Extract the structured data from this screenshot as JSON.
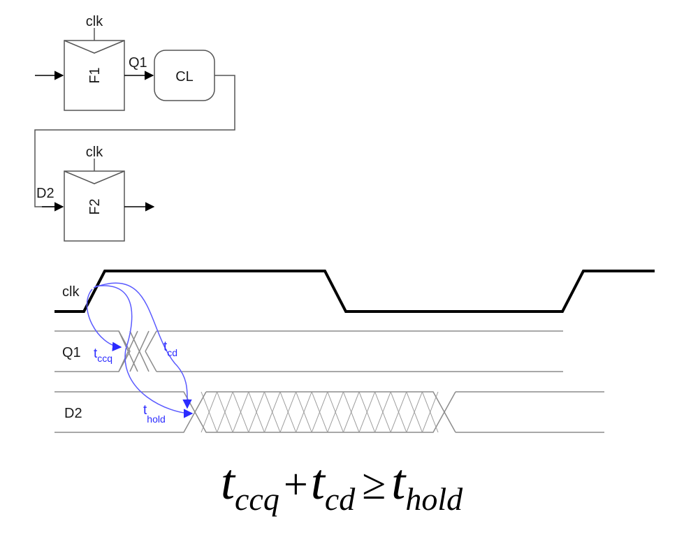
{
  "circuit": {
    "flop1": {
      "name": "F1",
      "clock_label": "clk",
      "output_label": "Q1"
    },
    "logic": {
      "name": "CL"
    },
    "flop2": {
      "name": "F2",
      "clock_label": "clk",
      "input_label": "D2"
    }
  },
  "timing": {
    "signals": {
      "clk": "clk",
      "q1": "Q1",
      "d2": "D2"
    },
    "delays": {
      "tccq": {
        "t": "t",
        "sub": "ccq"
      },
      "tcd": {
        "t": "t",
        "sub": "cd"
      },
      "thold": {
        "t": "t",
        "sub": "hold"
      }
    },
    "colors": {
      "annotation": "#2b2bff",
      "waveform": "#000000",
      "data_lines": "#8c8c8c"
    }
  },
  "equation": {
    "lhs1": {
      "t": "t",
      "sub": "ccq"
    },
    "plus": "+",
    "lhs2": {
      "t": "t",
      "sub": "cd"
    },
    "geq": "≥",
    "rhs": {
      "t": "t",
      "sub": "hold"
    }
  }
}
